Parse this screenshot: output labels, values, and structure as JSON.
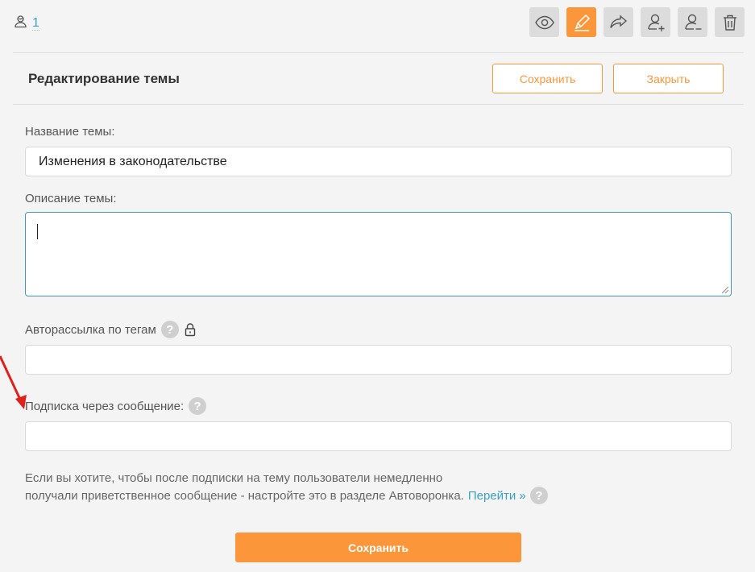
{
  "header": {
    "subscribers_count": "1"
  },
  "toolbar": {
    "buttons": [
      {
        "icon": "eye-icon",
        "active": false
      },
      {
        "icon": "pencil-icon",
        "active": true
      },
      {
        "icon": "share-icon",
        "active": false
      },
      {
        "icon": "add-user-icon",
        "active": false
      },
      {
        "icon": "remove-user-icon",
        "active": false
      },
      {
        "icon": "trash-icon",
        "active": false
      }
    ]
  },
  "editor": {
    "title": "Редактирование темы",
    "save_label": "Сохранить",
    "close_label": "Закрыть"
  },
  "form": {
    "topic_name_label": "Название темы:",
    "topic_name_value": "Изменения в законодательстве",
    "description_label": "Описание темы:",
    "description_value": "",
    "autosend_label": "Авторассылка по тегам",
    "autosend_value": "",
    "message_sub_label": "Подписка через сообщение:",
    "message_sub_value": ""
  },
  "note": {
    "line1": "Если вы хотите, чтобы после подписки на тему пользователи немедленно",
    "line2": "получали приветственное сообщение - настройте это в разделе Автоворонка.",
    "link": "Перейти »"
  },
  "footer": {
    "save_label": "Сохранить"
  },
  "colors": {
    "accent": "#fb963a",
    "link": "#3aa3c4",
    "annotation_arrow": "#e0201a"
  }
}
